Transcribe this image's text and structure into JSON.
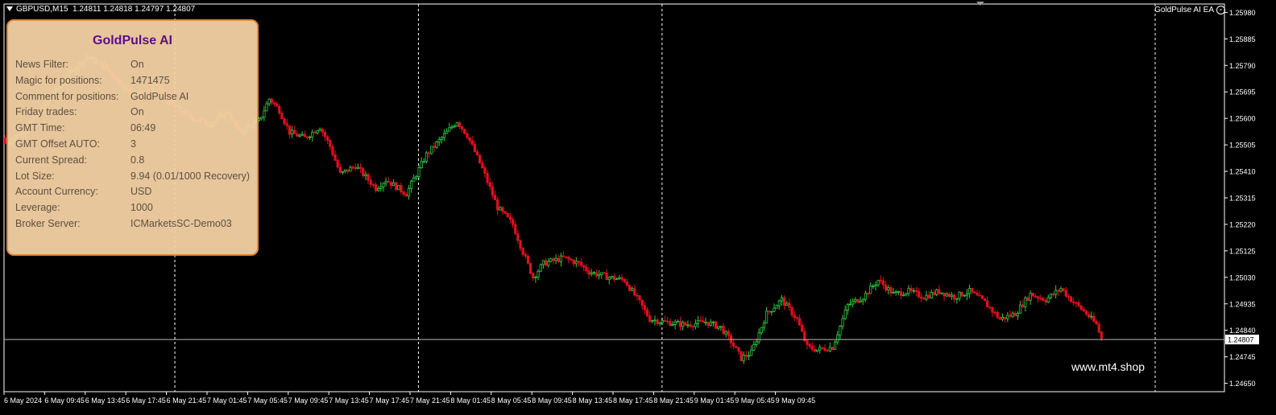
{
  "header": {
    "symbol_timeframe": "GBPUSD,M15",
    "ohlc": "1.24811 1.24818 1.24797 1.24807"
  },
  "ea_label": "GoldPulse AI EA",
  "panel": {
    "title": "GoldPulse AI",
    "rows": [
      {
        "label": "News Filter:",
        "value": "On"
      },
      {
        "label": "Magic for positions:",
        "value": "1471475"
      },
      {
        "label": "Comment for positions:",
        "value": "GoldPulse AI"
      },
      {
        "label": "Friday trades:",
        "value": "On"
      },
      {
        "label": "GMT Time:",
        "value": "06:49"
      },
      {
        "label": "GMT Offset AUTO:",
        "value": "3"
      },
      {
        "label": "Current Spread:",
        "value": "0.8"
      },
      {
        "label": "Lot Size:",
        "value": "9.94 (0.01/1000 Recovery)"
      },
      {
        "label": "Account Currency:",
        "value": "USD"
      },
      {
        "label": "Leverage:",
        "value": "1000"
      },
      {
        "label": "Broker Server:",
        "value": "ICMarketsSC-Demo03"
      }
    ]
  },
  "watermark": "www.mt4.shop",
  "current_price_label": "1.24807",
  "colors": {
    "background": "#000000",
    "bull_candle": "#2ecc40",
    "bear_candle": "#e0101e",
    "panel_bg": "#f5d2a5",
    "panel_border": "#e0883a",
    "panel_title": "#5a0e8c"
  },
  "chart_data": {
    "type": "candlestick",
    "price_axis_labels": [
      "1.25980",
      "1.25885",
      "1.25790",
      "1.25695",
      "1.25600",
      "1.25505",
      "1.25410",
      "1.25315",
      "1.25220",
      "1.25125",
      "1.25030",
      "1.24935",
      "1.24840",
      "1.24745",
      "1.24650"
    ],
    "ylim": [
      1.2462,
      1.2601
    ],
    "time_axis_labels": [
      "6 May 2024",
      "6 May 09:45",
      "6 May 13:45",
      "6 May 17:45",
      "6 May 21:45",
      "7 May 01:45",
      "7 May 05:45",
      "7 May 09:45",
      "7 May 13:45",
      "7 May 17:45",
      "7 May 21:45",
      "8 May 01:45",
      "8 May 05:45",
      "8 May 09:45",
      "8 May 13:45",
      "8 May 17:45",
      "8 May 21:45",
      "9 May 01:45",
      "9 May 05:45",
      "9 May 09:45"
    ],
    "session_separators": [
      "6 May 21:45",
      "7 May 21:45",
      "8 May 21:45",
      "9 May 21:45"
    ],
    "current_price": 1.24807,
    "close_path": [
      [
        0,
        1.2551
      ],
      [
        8,
        1.2556
      ],
      [
        16,
        1.2565
      ],
      [
        24,
        1.2575
      ],
      [
        32,
        1.2582
      ],
      [
        40,
        1.2578
      ],
      [
        48,
        1.257
      ],
      [
        56,
        1.2568
      ],
      [
        60,
        1.2572
      ],
      [
        64,
        1.2566
      ],
      [
        72,
        1.2561
      ],
      [
        80,
        1.2558
      ],
      [
        84,
        1.256
      ],
      [
        88,
        1.2562
      ],
      [
        92,
        1.2555
      ],
      [
        100,
        1.2559
      ],
      [
        104,
        1.2567
      ],
      [
        108,
        1.2563
      ],
      [
        112,
        1.2555
      ],
      [
        118,
        1.2553
      ],
      [
        124,
        1.2557
      ],
      [
        128,
        1.255
      ],
      [
        132,
        1.254
      ],
      [
        138,
        1.2543
      ],
      [
        146,
        1.2535
      ],
      [
        150,
        1.2538
      ],
      [
        158,
        1.2533
      ],
      [
        166,
        1.2547
      ],
      [
        172,
        1.2553
      ],
      [
        178,
        1.2559
      ],
      [
        182,
        1.2554
      ],
      [
        188,
        1.2542
      ],
      [
        194,
        1.2528
      ],
      [
        200,
        1.2522
      ],
      [
        204,
        1.2512
      ],
      [
        208,
        1.2503
      ],
      [
        212,
        1.2508
      ],
      [
        220,
        1.251
      ],
      [
        226,
        1.2508
      ],
      [
        230,
        1.2505
      ],
      [
        238,
        1.2503
      ],
      [
        244,
        1.2502
      ],
      [
        250,
        1.2494
      ],
      [
        254,
        1.2488
      ],
      [
        260,
        1.2487
      ],
      [
        268,
        1.2486
      ],
      [
        276,
        1.2487
      ],
      [
        282,
        1.2485
      ],
      [
        286,
        1.248
      ],
      [
        290,
        1.2474
      ],
      [
        294,
        1.2476
      ],
      [
        300,
        1.249
      ],
      [
        306,
        1.2495
      ],
      [
        312,
        1.2488
      ],
      [
        316,
        1.2478
      ],
      [
        320,
        1.2477
      ],
      [
        326,
        1.2478
      ],
      [
        332,
        1.2493
      ],
      [
        338,
        1.2496
      ],
      [
        344,
        1.2502
      ],
      [
        350,
        1.2497
      ],
      [
        356,
        1.2498
      ],
      [
        362,
        1.2496
      ],
      [
        368,
        1.2498
      ],
      [
        374,
        1.2496
      ],
      [
        380,
        1.2498
      ],
      [
        386,
        1.2494
      ],
      [
        392,
        1.2488
      ],
      [
        398,
        1.249
      ],
      [
        404,
        1.2497
      ],
      [
        410,
        1.2495
      ],
      [
        416,
        1.2499
      ],
      [
        420,
        1.2495
      ],
      [
        426,
        1.249
      ],
      [
        430,
        1.2486
      ],
      [
        432,
        1.2481
      ]
    ]
  }
}
